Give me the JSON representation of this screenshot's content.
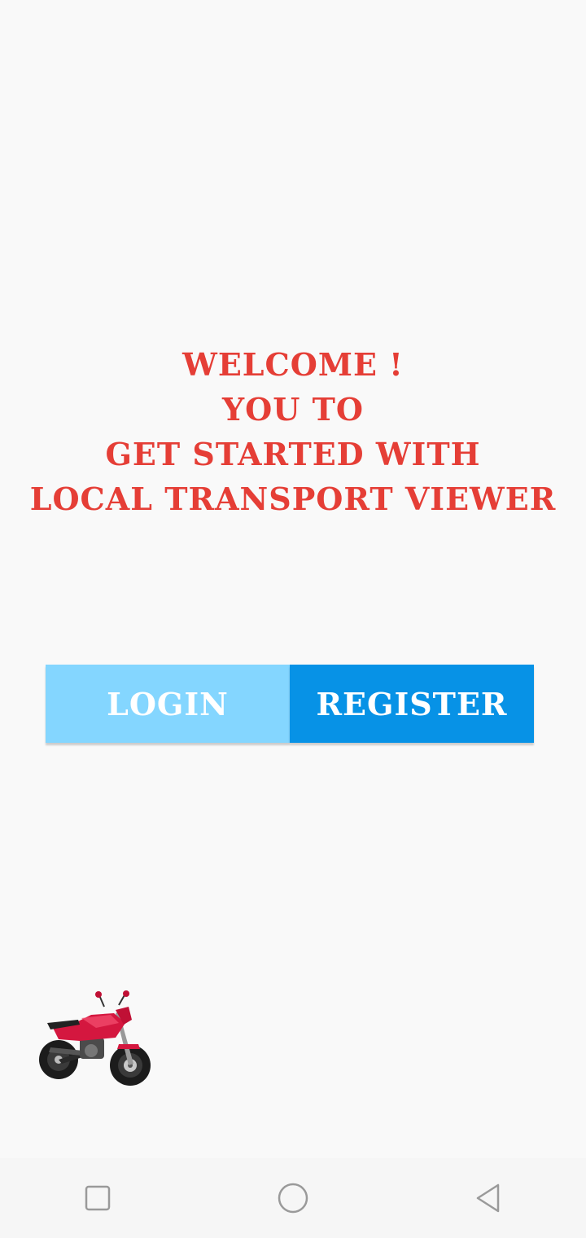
{
  "welcome": {
    "line1": "WELCOME !",
    "line2": "YOU TO",
    "line3": "GET STARTED WITH",
    "line4": "LOCAL TRANSPORT VIEWER"
  },
  "buttons": {
    "login_label": "LOGIN",
    "register_label": "REGISTER"
  },
  "colors": {
    "title": "#e53e36",
    "login_bg": "#84d6ff",
    "register_bg": "#0792e6",
    "background": "#f9f9f9"
  },
  "images": {
    "bike": "motorcycle-image"
  },
  "navbar": {
    "items": [
      "recent-apps-icon",
      "home-icon",
      "back-icon"
    ]
  }
}
